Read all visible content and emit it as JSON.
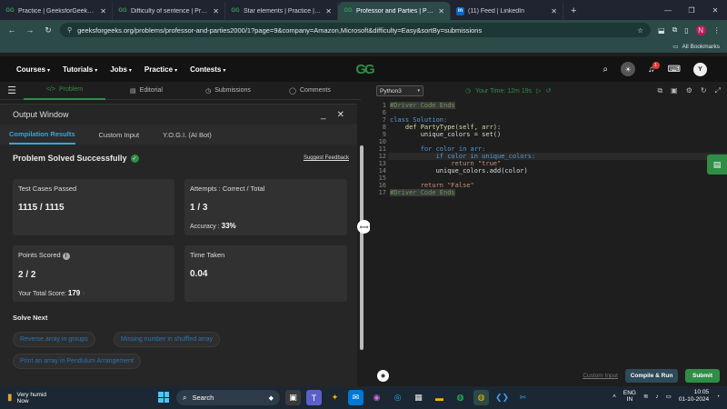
{
  "browser": {
    "tabs": [
      {
        "label": "Practice | GeeksforGeeks | A co",
        "icon": "gfg",
        "active": false
      },
      {
        "label": "Difficulty of sentence | Practice",
        "icon": "gfg",
        "active": false
      },
      {
        "label": "Star elements | Practice | Geeks",
        "icon": "gfg",
        "active": false
      },
      {
        "label": "Professor and Parties | Practice",
        "icon": "gfg",
        "active": true
      },
      {
        "label": "(11) Feed | LinkedIn",
        "icon": "in",
        "active": false
      }
    ],
    "new_tab": "+",
    "url": "geeksforgeeks.org/problems/professor-and-parties2000/1?page=9&company=Amazon,Microsoft&difficulty=Easy&sortBy=submissions",
    "profile_initial": "N",
    "bookmarks_label": "All Bookmarks"
  },
  "gfg_nav": {
    "logo": "GG",
    "menus": [
      "Courses",
      "Tutorials",
      "Jobs",
      "Practice",
      "Contests"
    ],
    "notification_count": "1",
    "avatar_initial": "Y"
  },
  "problem_tabs": [
    {
      "label": "Problem",
      "icon": "</>",
      "active": true
    },
    {
      "label": "Editorial",
      "icon": "▤",
      "active": false
    },
    {
      "label": "Submissions",
      "icon": "◷",
      "active": false
    },
    {
      "label": "Comments",
      "icon": "◯",
      "active": false
    }
  ],
  "output": {
    "title": "Output Window",
    "tabs": [
      "Compilation Results",
      "Custom Input",
      "Y.O.G.I. (AI Bot)"
    ],
    "status": "Problem Solved Successfully",
    "feedback": "Suggest Feedback",
    "test_cases_label": "Test Cases Passed",
    "test_cases_value": "1115 / 1115",
    "attempts_label": "Attempts : Correct / Total",
    "attempts_value": "1 / 3",
    "accuracy_label": "Accuracy :",
    "accuracy_value": "33%",
    "points_label": "Points Scored",
    "points_value": "2 / 2",
    "total_score_label": "Your Total Score:",
    "total_score_value": "179",
    "time_label": "Time Taken",
    "time_value": "0.04",
    "solve_next_title": "Solve Next",
    "solve_next": [
      "Reverse array in groups",
      "Missing number in shuffled array",
      "Print an array in Pendulum Arrangement"
    ]
  },
  "editor": {
    "language": "Python3",
    "timer": "Your Time: 12m 19s",
    "line_numbers": [
      "1",
      "6",
      "7",
      "8",
      "9",
      "10",
      "11",
      "12",
      "13",
      "14",
      "15",
      "16",
      "17"
    ],
    "code_lines": [
      "#Driver Code Ends",
      "",
      "class Solution:",
      "    def PartyType(self, arr):",
      "        unique_colors = set()",
      "",
      "        for color in arr:",
      "            if color in unique_colors:",
      "                return \"true\"",
      "            unique_colors.add(color)",
      "",
      "        return \"False\"",
      "#Driver Code Ends"
    ],
    "custom_input": "Custom Input",
    "compile_run": "Compile & Run",
    "submit": "Submit"
  },
  "taskbar": {
    "weather": "Very humid",
    "weather_sub": "Now",
    "search": "Search",
    "lang_line1": "ENG",
    "lang_line2": "IN",
    "time": "10:05",
    "date": "01-10-2024"
  }
}
